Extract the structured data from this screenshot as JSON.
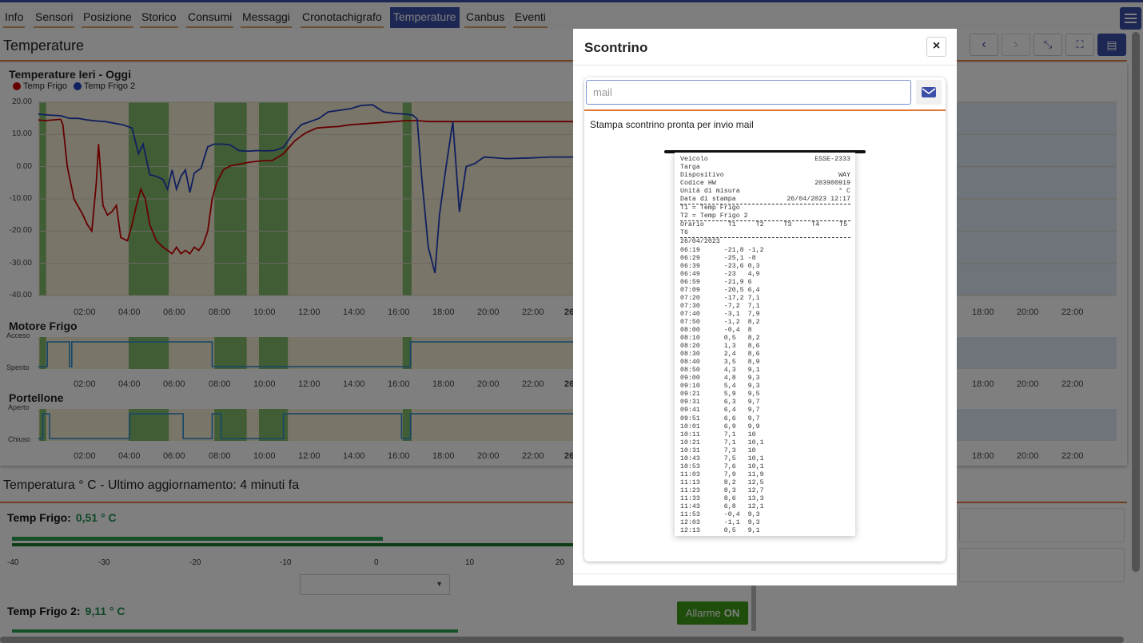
{
  "nav": {
    "tabs": [
      {
        "label": "Info"
      },
      {
        "label": "Sensori"
      },
      {
        "label": "Posizione"
      },
      {
        "label": "Storico"
      },
      {
        "label": "Consumi"
      },
      {
        "label": "Messaggi"
      },
      {
        "label": "Cronotachigrafo"
      },
      {
        "label": "Temperature"
      },
      {
        "label": "Canbus"
      },
      {
        "label": "Eventi"
      }
    ],
    "active": "Temperature"
  },
  "page": {
    "title": "Temperature",
    "chart_title": "Temperature Ieri - Oggi",
    "legend": [
      {
        "name": "Temp Frigo",
        "color": "#cc0000"
      },
      {
        "name": "Temp Frigo 2",
        "color": "#1f3fbf"
      }
    ],
    "motore_title": "Motore Frigo",
    "motore_states": {
      "on": "Acceso",
      "off": "Spento"
    },
    "portellone_title": "Portellone",
    "portellone_states": {
      "on": "Aperto",
      "off": "Chiuso"
    },
    "x_ticks": [
      "02:00",
      "04:00",
      "06:00",
      "08:00",
      "10:00",
      "12:00",
      "14:00",
      "16:00",
      "18:00",
      "20:00",
      "22:00",
      "26"
    ],
    "x_ticks_right": [
      "18:00",
      "20:00",
      "22:00"
    ],
    "y_ticks": [
      "20.00",
      "10.00",
      "0.00",
      "-10.00",
      "-20.00",
      "-30.00",
      "-40.00"
    ]
  },
  "chart_data": {
    "type": "line",
    "title": "Temperature Ieri - Oggi",
    "ylim": [
      -40,
      20
    ],
    "x_unit": "hours",
    "series": [
      {
        "name": "Temp Frigo",
        "color": "#cc0000",
        "x": [
          0,
          0.3,
          1.0,
          1.1,
          1.3,
          1.6,
          2.0,
          2.2,
          2.4,
          2.6,
          2.7,
          2.9,
          3.1,
          3.3,
          3.5,
          3.7,
          4.0,
          4.2,
          4.4,
          4.6,
          4.8,
          5.0,
          5.3,
          5.6,
          5.8,
          6.0,
          6.2,
          6.4,
          6.6,
          6.8,
          7.0,
          7.2,
          7.4,
          7.6,
          7.8,
          8.0,
          8.3,
          8.6,
          9.0,
          9.5,
          10.0,
          10.5,
          11.0,
          11.5,
          12.0,
          12.5,
          13.0,
          13.5,
          14.0,
          15.0,
          16.0,
          16.5,
          17.0,
          17.5,
          18.0,
          19.0,
          20.0,
          21.0,
          22.0,
          23.0,
          24.0
        ],
        "y": [
          14.5,
          14.3,
          14.7,
          13,
          0,
          -10,
          -15,
          -18,
          -20,
          -5,
          7,
          -12,
          -15,
          -14,
          -12,
          -22,
          -23,
          -18,
          -12,
          -7,
          -10,
          -18,
          -23,
          -25,
          -26,
          -27,
          -25,
          -27,
          -26,
          -27,
          -25,
          -26,
          -24,
          -20,
          -10,
          -5,
          -1,
          0.2,
          0.8,
          1.4,
          1.8,
          1.9,
          4,
          8,
          10.5,
          12,
          12.3,
          12.5,
          13,
          13.5,
          14,
          14.3,
          14.3,
          14,
          14,
          14,
          14,
          14,
          14,
          14,
          14
        ]
      },
      {
        "name": "Temp Frigo 2",
        "color": "#1f3fbf",
        "x": [
          0,
          0.5,
          1.0,
          1.4,
          1.8,
          2.2,
          2.6,
          3.0,
          3.4,
          3.8,
          4.2,
          4.5,
          4.7,
          5.0,
          5.3,
          5.6,
          5.8,
          6.0,
          6.2,
          6.4,
          6.6,
          6.8,
          7.0,
          7.3,
          7.6,
          7.9,
          8.2,
          8.6,
          9.0,
          9.4,
          9.8,
          10.2,
          10.6,
          11.0,
          11.4,
          11.8,
          12.2,
          12.6,
          13.0,
          13.5,
          14.0,
          14.5,
          15.0,
          15.5,
          16.0,
          16.5,
          16.8,
          17.0,
          17.2,
          17.5,
          17.8,
          18.0,
          18.3,
          18.6,
          18.9,
          19.2,
          19.6,
          20.0,
          21.0,
          22.0,
          23.0,
          24.0
        ],
        "y": [
          16.3,
          16,
          15.8,
          15,
          15,
          14.5,
          14.2,
          14,
          13.5,
          13,
          12,
          4,
          7,
          -2.5,
          -3,
          -4,
          -7,
          -1,
          -7,
          -3,
          -1,
          -8,
          -2,
          -0.5,
          6.2,
          7,
          7,
          6.8,
          5,
          4.8,
          5,
          4.9,
          5,
          6,
          10,
          13,
          14,
          15,
          17,
          17.5,
          18,
          19,
          19.2,
          17,
          16.5,
          16.3,
          16,
          14.8,
          -3,
          -25,
          -33,
          -15,
          0,
          14,
          -14,
          0,
          1,
          3,
          2.5,
          2.7,
          3,
          3
        ]
      }
    ]
  },
  "modal": {
    "title": "Scontrino",
    "mail_placeholder": "mail",
    "ready_text": "Stampa scontrino pronta per invio mail",
    "receipt_header": [
      {
        "k": "Veicolo",
        "v": "ESSE-2333"
      },
      {
        "k": "Targa",
        "v": ""
      },
      {
        "k": "Dispositivo",
        "v": "WAY"
      },
      {
        "k": "Codice HW",
        "v": "203900919"
      },
      {
        "k": "Unità di misura",
        "v": "° C"
      },
      {
        "k": "Data di stampa",
        "v": "26/04/2023 12:17"
      }
    ],
    "receipt_legend": [
      "T1 = Temp Frigo",
      "T2 = Temp Frigo 2"
    ],
    "receipt_columns": "Orario      T1     T2     T3     T4     T5",
    "receipt_columns_2": "T6",
    "receipt_date": "26/04/2023",
    "receipt_rows": [
      "06:19      -21,8 -1,2",
      "06:29      -25,1 -8",
      "06:39      -23,6 0,3",
      "06:49      -23   4,9",
      "06:59      -21,9 6",
      "07:09      -20,5 6,4",
      "07:20      -17,2 7,1",
      "07:30      -7,2  7,1",
      "07:40      -3,1  7,9",
      "07:50      -1,2  8,2",
      "08:00      -0,4  8",
      "08:10      0,5   8,2",
      "08:20      1,3   8,6",
      "08:30      2,4   8,6",
      "08:40      3,5   8,9",
      "08:50      4,3   9,1",
      "09:00      4,8   9,3",
      "09:10      5,4   9,3",
      "09:21      5,9   9,5",
      "09:31      6,3   9,7",
      "09:41      6,4   9,7",
      "09:51      6,6   9,7",
      "10:01      6,9   9,9",
      "10:11      7,1   10",
      "10:21      7,1   10,1",
      "10:31      7,3   10",
      "10:43      7,5   10,1",
      "10:53      7,6   10,1",
      "11:03      7,9   11,9",
      "11:13      8,2   12,5",
      "11:23      8,3   12,7",
      "11:33      8,6   13,3",
      "11:43      6,8   12,1",
      "11:53      -0,4  9,3",
      "12:03      -1,1  9,3",
      "12:13      0,5   9,1"
    ]
  },
  "bottom": {
    "title": "Temperatura ° C - Ultimo aggiornamento: 4 minuti fa",
    "gauge1_label": "Temp Frigo:",
    "gauge1_value": "0,51 ° C",
    "gauge2_label": "Temp Frigo 2:",
    "gauge2_value": "9,11 ° C",
    "scale": [
      "-40",
      "-30",
      "-20",
      "-10",
      "0",
      "10",
      "20"
    ],
    "alarm_label": "Allarme",
    "alarm_state": "ON"
  }
}
